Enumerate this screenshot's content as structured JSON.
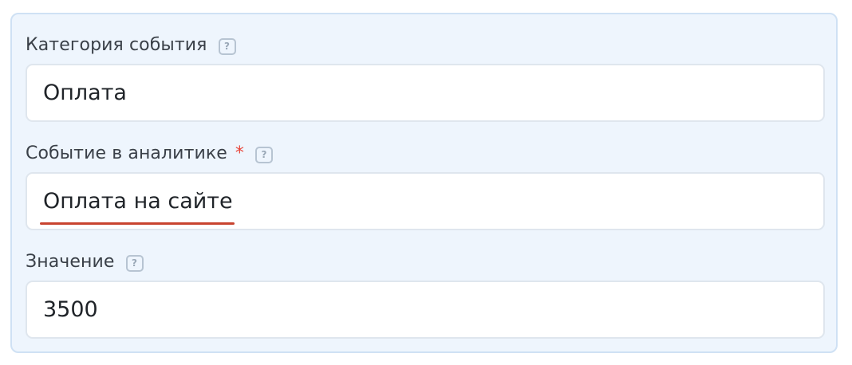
{
  "form": {
    "category": {
      "label": "Категория события",
      "value": "Оплата",
      "help_icon": "question-mark-icon"
    },
    "event": {
      "label": "Событие в аналитике",
      "required_mark": "*",
      "value": "Оплата на сайте",
      "help_icon": "question-mark-icon",
      "spellcheck_underline_color": "#c8432f"
    },
    "value_field": {
      "label": "Значение",
      "value": "3500",
      "help_icon": "question-mark-icon"
    },
    "help_glyph": "?"
  },
  "colors": {
    "panel_background": "#eef5fd",
    "panel_border": "#cfe1f4",
    "required": "#e8463a"
  }
}
